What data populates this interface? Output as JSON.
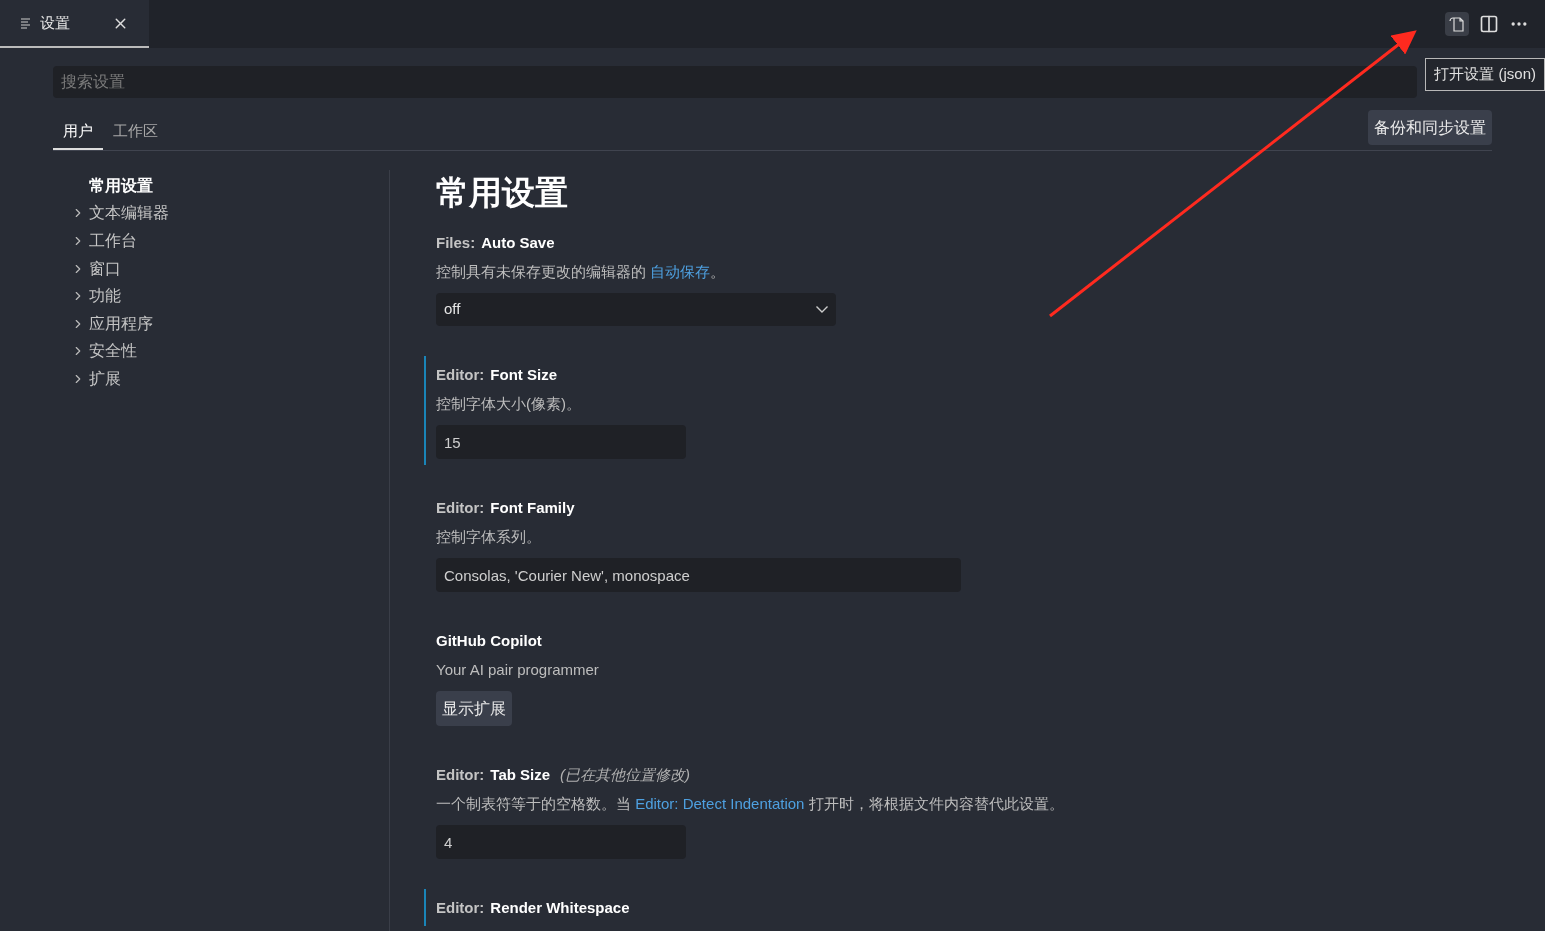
{
  "editor_tab": {
    "label": "设置",
    "selected": true
  },
  "toolbar": {
    "tooltip": "打开设置 (json)"
  },
  "search": {
    "placeholder": "搜索设置"
  },
  "scope_tabs": [
    {
      "label": "用户",
      "selected": true
    },
    {
      "label": "工作区",
      "selected": false
    }
  ],
  "sync_button": "备份和同步设置",
  "toc": [
    {
      "label": "常用设置",
      "selected": true,
      "expandable": false
    },
    {
      "label": "文本编辑器",
      "selected": false,
      "expandable": true
    },
    {
      "label": "工作台",
      "selected": false,
      "expandable": true
    },
    {
      "label": "窗口",
      "selected": false,
      "expandable": true
    },
    {
      "label": "功能",
      "selected": false,
      "expandable": true
    },
    {
      "label": "应用程序",
      "selected": false,
      "expandable": true
    },
    {
      "label": "安全性",
      "selected": false,
      "expandable": true
    },
    {
      "label": "扩展",
      "selected": false,
      "expandable": true
    }
  ],
  "section_title": "常用设置",
  "settings": [
    {
      "kind": "select",
      "category": "Files:",
      "title": "Auto Save",
      "description": [
        {
          "text": "控制具有未保存更改的编辑器的 "
        },
        {
          "text": "自动保存",
          "link": true
        },
        {
          "text": "。"
        }
      ],
      "value": "off",
      "modified": false
    },
    {
      "kind": "number",
      "category": "Editor:",
      "title": "Font Size",
      "description": [
        {
          "text": "控制字体大小(像素)。"
        }
      ],
      "value": "15",
      "modified": true
    },
    {
      "kind": "text",
      "category": "Editor:",
      "title": "Font Family",
      "description": [
        {
          "text": "控制字体系列。"
        }
      ],
      "value": "Consolas, 'Courier New', monospace",
      "modified": false
    },
    {
      "kind": "button",
      "title": "GitHub Copilot",
      "description": [
        {
          "text": "Your AI pair programmer"
        }
      ],
      "value": "显示扩展",
      "modified": false
    },
    {
      "kind": "number",
      "category": "Editor:",
      "title": "Tab Size",
      "note": "(已在其他位置修改)",
      "description": [
        {
          "text": "一个制表符等于的空格数。当 "
        },
        {
          "text": "Editor: Detect Indentation",
          "link": true
        },
        {
          "text": " 打开时，将根据文件内容替代此设置。"
        }
      ],
      "value": "4",
      "modified": false
    },
    {
      "category": "Editor:",
      "title": "Render Whitespace",
      "modified": true
    }
  ]
}
